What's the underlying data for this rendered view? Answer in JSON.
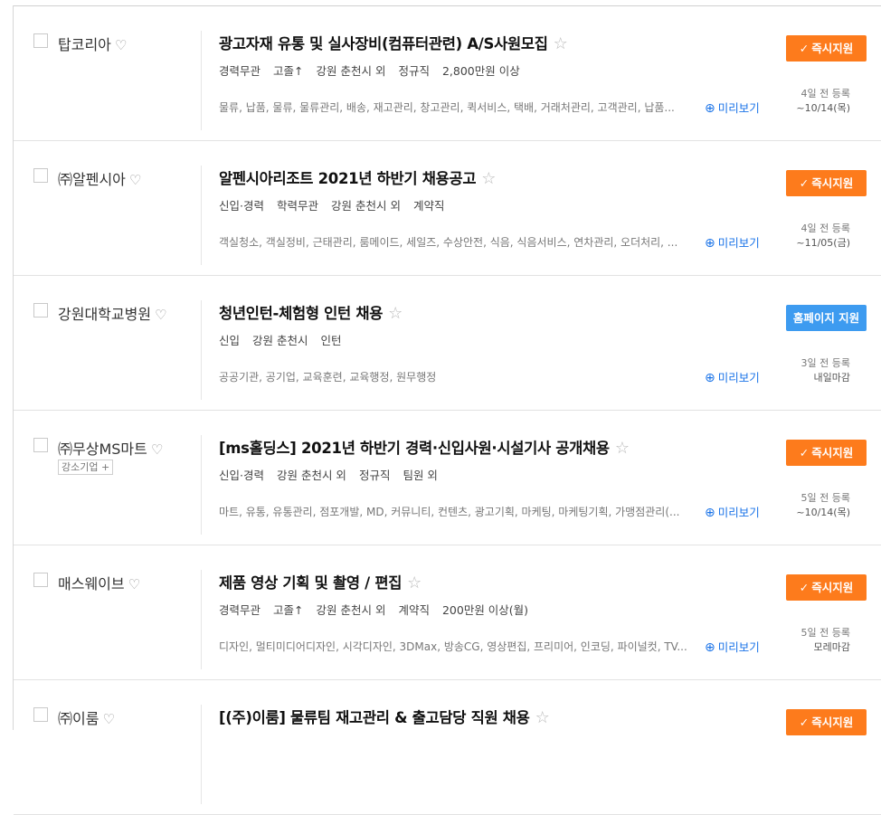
{
  "icons": {
    "heart": "♡",
    "star": "☆",
    "check": "✓",
    "magnifier-plus": "⊕"
  },
  "colors": {
    "apply_button": "#fd7b1c",
    "homepage_button": "#3d9bf0",
    "preview_link": "#1a73e8"
  },
  "jobs": [
    {
      "company": "탑코리아",
      "badge": "",
      "title": "광고자재 유통 및 실사장비(컴퓨터관련) A/S사원모집",
      "conditions": [
        "경력무관",
        "고졸↑",
        "강원 춘천시 외",
        "정규직",
        "2,800만원 이상"
      ],
      "tags": "물류, 납품, 물류, 물류관리, 배송, 재고관리, 창고관리, 퀵서비스, 택배, 거래처관리, 고객관리, 납품...",
      "preview": "미리보기",
      "button": "즉시지원",
      "button_type": "apply",
      "posted": "4일 전 등록",
      "deadline": "~10/14(목)"
    },
    {
      "company": "㈜알펜시아",
      "badge": "",
      "title": "알펜시아리조트 2021년 하반기 채용공고",
      "conditions": [
        "신입·경력",
        "학력무관",
        "강원 춘천시 외",
        "계약직"
      ],
      "tags": "객실청소, 객실정비, 근태관리, 룸메이드, 세일즈, 수상안전, 식음, 식음서비스, 연차관리, 오더처리, ...",
      "preview": "미리보기",
      "button": "즉시지원",
      "button_type": "apply",
      "posted": "4일 전 등록",
      "deadline": "~11/05(금)"
    },
    {
      "company": "강원대학교병원",
      "badge": "",
      "title": "청년인턴-체험형 인턴 채용",
      "conditions": [
        "신입",
        "강원 춘천시",
        "인턴"
      ],
      "tags": "공공기관, 공기업, 교육훈련, 교육행정, 원무행정",
      "preview": "미리보기",
      "button": "홈페이지 지원",
      "button_type": "homepage",
      "posted": "3일 전 등록",
      "deadline": "내일마감"
    },
    {
      "company": "㈜무상MS마트",
      "badge": "강소기업 +",
      "title": "[ms홀딩스] 2021년 하반기 경력·신입사원·시설기사 공개채용",
      "conditions": [
        "신입·경력",
        "강원 춘천시 외",
        "정규직",
        "팀원 외"
      ],
      "tags": "마트, 유통, 유통관리, 점포개발, MD, 커뮤니티, 컨텐츠, 광고기획, 마케팅, 마케팅기획, 가맹점관리(...",
      "preview": "미리보기",
      "button": "즉시지원",
      "button_type": "apply",
      "posted": "5일 전 등록",
      "deadline": "~10/14(목)"
    },
    {
      "company": "매스웨이브",
      "badge": "",
      "title": "제품 영상 기획 및 촬영 / 편집",
      "conditions": [
        "경력무관",
        "고졸↑",
        "강원 춘천시 외",
        "계약직",
        "200만원 이상(월)"
      ],
      "tags": "디자인, 멀티미디어디자인, 시각디자인, 3DMax, 방송CG, 영상편집, 프리미어, 인코딩, 파이널컷, TV...",
      "preview": "미리보기",
      "button": "즉시지원",
      "button_type": "apply",
      "posted": "5일 전 등록",
      "deadline": "모레마감"
    },
    {
      "company": "㈜이룸",
      "badge": "",
      "title": "[(주)이룸] 물류팀 재고관리 & 출고담당 직원 채용",
      "conditions": [],
      "tags": "",
      "preview": "",
      "button": "즉시지원",
      "button_type": "apply",
      "posted": "",
      "deadline": ""
    }
  ]
}
